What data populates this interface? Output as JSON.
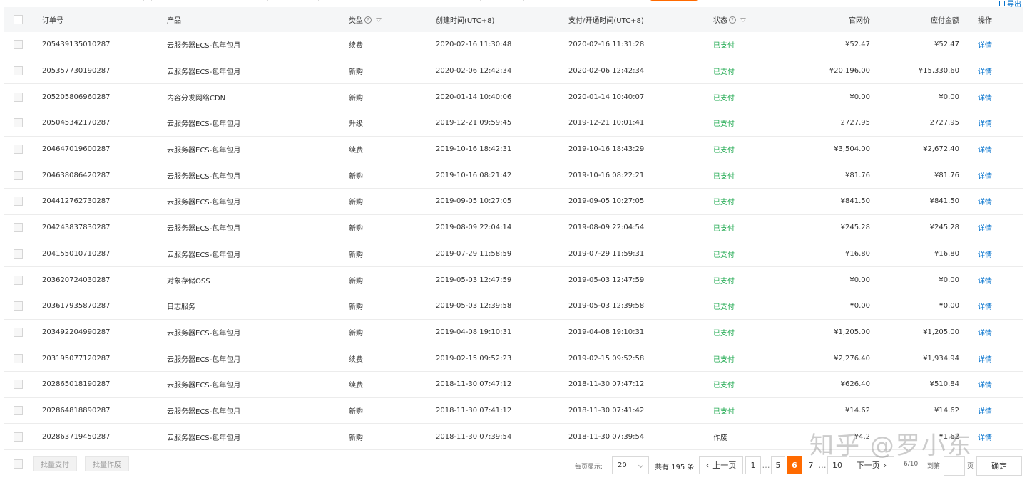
{
  "toolbar": {
    "export_label": "导出"
  },
  "table": {
    "headers": {
      "order_no": "订单号",
      "product": "产品",
      "type": "类型",
      "created": "创建时间(UTC+8)",
      "paid": "支付/开通时间(UTC+8)",
      "status": "状态",
      "list_price": "官网价",
      "amount": "应付金额",
      "action": "操作"
    },
    "rows": [
      {
        "order_no": "205439135010287",
        "product": "云服务器ECS-包年包月",
        "type": "续费",
        "created": "2020-02-16 11:30:48",
        "paid": "2020-02-16 11:31:28",
        "status": "已支付",
        "list_price": "¥52.47",
        "amount": "¥52.47",
        "action": "详情"
      },
      {
        "order_no": "205357730190287",
        "product": "云服务器ECS-包年包月",
        "type": "新购",
        "created": "2020-02-06 12:42:34",
        "paid": "2020-02-06 12:42:34",
        "status": "已支付",
        "list_price": "¥20,196.00",
        "amount": "¥15,330.60",
        "action": "详情"
      },
      {
        "order_no": "205205806960287",
        "product": "内容分发网络CDN",
        "type": "新购",
        "created": "2020-01-14 10:40:06",
        "paid": "2020-01-14 10:40:07",
        "status": "已支付",
        "list_price": "¥0.00",
        "amount": "¥0.00",
        "action": "详情"
      },
      {
        "order_no": "205045342170287",
        "product": "云服务器ECS-包年包月",
        "type": "升级",
        "created": "2019-12-21 09:59:45",
        "paid": "2019-12-21 10:01:41",
        "status": "已支付",
        "list_price": "2727.95",
        "amount": "2727.95",
        "action": "详情"
      },
      {
        "order_no": "204647019600287",
        "product": "云服务器ECS-包年包月",
        "type": "续费",
        "created": "2019-10-16 18:42:31",
        "paid": "2019-10-16 18:43:29",
        "status": "已支付",
        "list_price": "¥3,504.00",
        "amount": "¥2,672.40",
        "action": "详情"
      },
      {
        "order_no": "204638086420287",
        "product": "云服务器ECS-包年包月",
        "type": "新购",
        "created": "2019-10-16 08:21:42",
        "paid": "2019-10-16 08:22:21",
        "status": "已支付",
        "list_price": "¥81.76",
        "amount": "¥81.76",
        "action": "详情"
      },
      {
        "order_no": "204412762730287",
        "product": "云服务器ECS-包年包月",
        "type": "新购",
        "created": "2019-09-05 10:27:05",
        "paid": "2019-09-05 10:27:05",
        "status": "已支付",
        "list_price": "¥841.50",
        "amount": "¥841.50",
        "action": "详情"
      },
      {
        "order_no": "204243837830287",
        "product": "云服务器ECS-包年包月",
        "type": "新购",
        "created": "2019-08-09 22:04:14",
        "paid": "2019-08-09 22:04:54",
        "status": "已支付",
        "list_price": "¥245.28",
        "amount": "¥245.28",
        "action": "详情"
      },
      {
        "order_no": "204155010710287",
        "product": "云服务器ECS-包年包月",
        "type": "新购",
        "created": "2019-07-29 11:58:59",
        "paid": "2019-07-29 11:59:31",
        "status": "已支付",
        "list_price": "¥16.80",
        "amount": "¥16.80",
        "action": "详情"
      },
      {
        "order_no": "203620724030287",
        "product": "对象存储OSS",
        "type": "新购",
        "created": "2019-05-03 12:47:59",
        "paid": "2019-05-03 12:47:59",
        "status": "已支付",
        "list_price": "¥0.00",
        "amount": "¥0.00",
        "action": "详情"
      },
      {
        "order_no": "203617935870287",
        "product": "日志服务",
        "type": "新购",
        "created": "2019-05-03 12:39:58",
        "paid": "2019-05-03 12:39:58",
        "status": "已支付",
        "list_price": "¥0.00",
        "amount": "¥0.00",
        "action": "详情"
      },
      {
        "order_no": "203492204990287",
        "product": "云服务器ECS-包年包月",
        "type": "新购",
        "created": "2019-04-08 19:10:31",
        "paid": "2019-04-08 19:10:31",
        "status": "已支付",
        "list_price": "¥1,205.00",
        "amount": "¥1,205.00",
        "action": "详情"
      },
      {
        "order_no": "203195077120287",
        "product": "云服务器ECS-包年包月",
        "type": "续费",
        "created": "2019-02-15 09:52:23",
        "paid": "2019-02-15 09:52:58",
        "status": "已支付",
        "list_price": "¥2,276.40",
        "amount": "¥1,934.94",
        "action": "详情"
      },
      {
        "order_no": "202865018190287",
        "product": "云服务器ECS-包年包月",
        "type": "续费",
        "created": "2018-11-30 07:47:12",
        "paid": "2018-11-30 07:47:12",
        "status": "已支付",
        "list_price": "¥626.40",
        "amount": "¥510.84",
        "action": "详情"
      },
      {
        "order_no": "202864818890287",
        "product": "云服务器ECS-包年包月",
        "type": "新购",
        "created": "2018-11-30 07:41:12",
        "paid": "2018-11-30 07:41:42",
        "status": "已支付",
        "list_price": "¥14.62",
        "amount": "¥14.62",
        "action": "详情"
      },
      {
        "order_no": "202863719450287",
        "product": "云服务器ECS-包年包月",
        "type": "新购",
        "created": "2018-11-30 07:39:54",
        "paid": "2018-11-30 07:39:54",
        "status": "作废",
        "list_price": "¥4.2",
        "amount": "¥1.62",
        "action": "详情"
      }
    ]
  },
  "footer": {
    "batch_pay": "批量支付",
    "batch_void": "批量作废",
    "page_size_label": "每页显示:",
    "page_size_value": "20",
    "total": "共有 195 条",
    "prev": "上一页",
    "next": "下一页",
    "pages": [
      "1",
      "…",
      "5",
      "6",
      "7",
      "…",
      "10"
    ],
    "current_page": "6",
    "page_of": "6/10",
    "goto_label": "到第",
    "page_unit": "页",
    "confirm": "确定"
  },
  "watermark": "知乎 @罗小东",
  "colors": {
    "accent": "#ff6a00",
    "link": "#0070cc",
    "paid_green": "#1ea94f"
  }
}
